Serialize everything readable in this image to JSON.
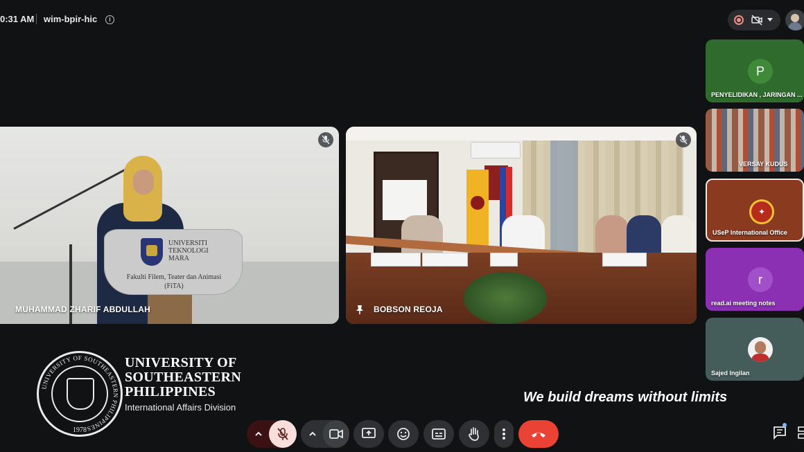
{
  "meeting": {
    "time": "0:31 AM",
    "code": "wim-bpir-hic",
    "info_icon": "info-icon"
  },
  "top_right": {
    "recording_icon": "record-icon",
    "camera_off_icon": "camera-off-icon",
    "menu_icon": "chevron-down-icon",
    "self_avatar_icon": "avatar"
  },
  "main_tiles": [
    {
      "name": "MUHAMMAD ZHARIF ABDULLAH",
      "muted": true,
      "podium_university": "UNIVERSITI\nTEKNOLOGI\nMARA",
      "podium_faculty": "Fakulti Filem, Teater dan Animasi\n(FiTA)"
    },
    {
      "name": "BOBSON REOJA",
      "muted": true,
      "pinned": true
    }
  ],
  "side_tiles": [
    {
      "label": "PENYELIDIKAN , JARINGAN ...",
      "avatar_letter": "P",
      "color": "#2e6b2c"
    },
    {
      "label": "VERSAY KUDUS",
      "video": true
    },
    {
      "label": "USeP International Office",
      "avatar_type": "seal",
      "color": "#8a3a1f"
    },
    {
      "label": "read.ai meeting notes",
      "avatar_letter": "r",
      "color": "#8b2fb3"
    },
    {
      "label": "Sajed Ingilan",
      "avatar_type": "photo",
      "color": "#445c5a"
    }
  ],
  "branding": {
    "university_name": "UNIVERSITY OF SOUTHEASTERN PHILIPPINES",
    "division": "International Affairs Division",
    "seal_text": "UNIVERSITY OF SOUTHEASTERN PHILIPPINES",
    "seal_year": "1978",
    "tagline": "We build dreams without limits"
  },
  "controls": {
    "mic_caret_icon": "chevron-up-icon",
    "mic_icon": "mic-off-icon",
    "cam_caret_icon": "chevron-up-icon",
    "cam_icon": "videocam-icon",
    "present_icon": "present-screen-icon",
    "emoji_icon": "emoji-icon",
    "captions_icon": "captions-icon",
    "raise_hand_icon": "raise-hand-icon",
    "more_icon": "more-vert-icon",
    "end_call_icon": "end-call-icon",
    "chat_icon": "chat-icon"
  },
  "colors": {
    "background": "#111214",
    "end_call": "#ea4335",
    "mic_off_bg": "#f9dedc",
    "accent": "#8ab4f8"
  }
}
